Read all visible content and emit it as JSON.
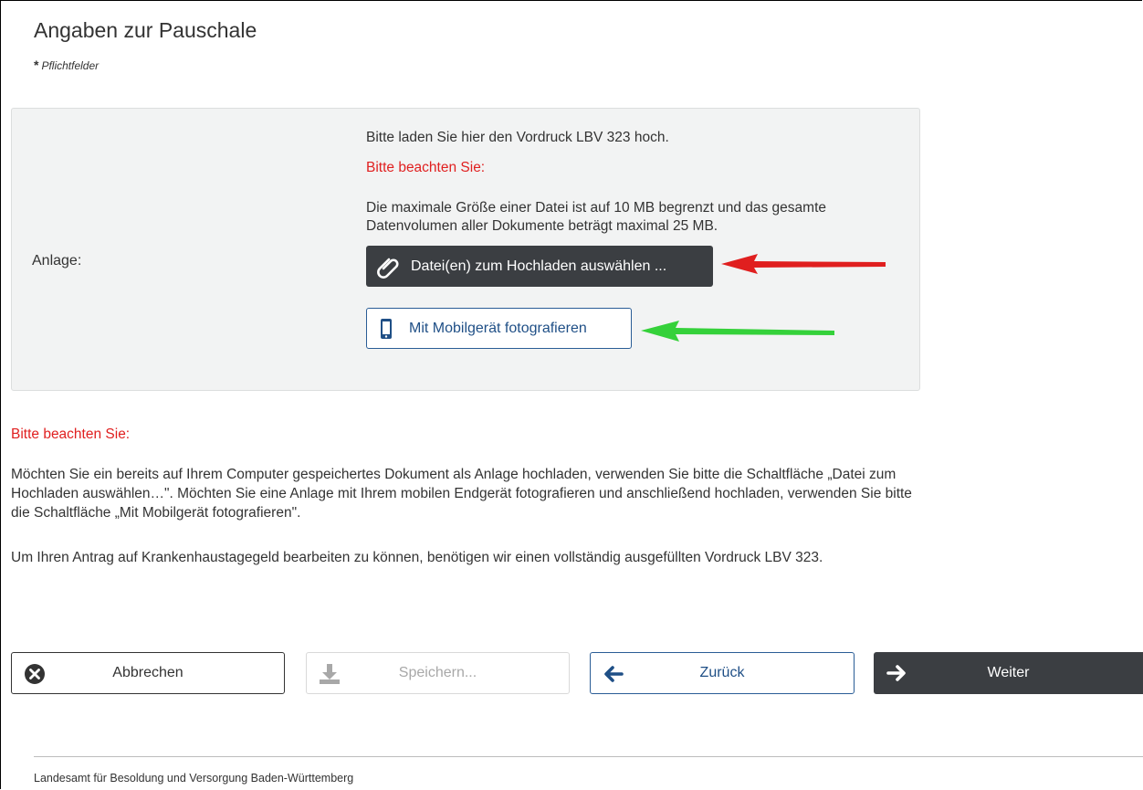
{
  "header": {
    "title": "Angaben zur Pauschale",
    "required_marker": "*",
    "required_text": "Pflichtfelder"
  },
  "upload_section": {
    "label": "Anlage:",
    "instruction": "Bitte laden Sie hier den Vordruck LBV 323 hoch.",
    "note_heading": "Bitte beachten Sie:",
    "size_limit_text": "Die maximale Größe einer Datei ist auf 10 MB begrenzt und das gesamte Datenvolumen aller Dokumente beträgt maximal 25 MB.",
    "upload_button": "Datei(en) zum Hochladen auswählen ...",
    "mobile_button": "Mit Mobilgerät fotografieren"
  },
  "annotations": {
    "arrow_upload_color": "#e01f1f",
    "arrow_mobile_color": "#35d13a"
  },
  "notes": {
    "heading": "Bitte beachten Sie:",
    "paragraph1": "Möchten Sie ein bereits auf Ihrem Computer gespeichertes Dokument als Anlage hochladen, verwenden Sie bitte die Schaltfläche „Datei zum Hochladen auswählen…\". Möchten Sie eine Anlage mit Ihrem mobilen Endgerät fotografieren und anschließend hochladen, verwenden Sie bitte die Schaltfläche „Mit Mobilgerät fotografieren\".",
    "paragraph2": "Um Ihren Antrag auf Krankenhaustagegeld bearbeiten zu können, benötigen wir einen vollständig ausgefüllten Vordruck LBV 323."
  },
  "nav": {
    "cancel": "Abbrechen",
    "save": "Speichern...",
    "back": "Zurück",
    "next": "Weiter"
  },
  "footer": {
    "text": "Landesamt für Besoldung und Versorgung Baden-Württemberg"
  },
  "colors": {
    "dark_button": "#3b3e42",
    "link_blue": "#1f4f86",
    "warning_red": "#e01f1f",
    "panel_bg": "#f2f3f3"
  }
}
